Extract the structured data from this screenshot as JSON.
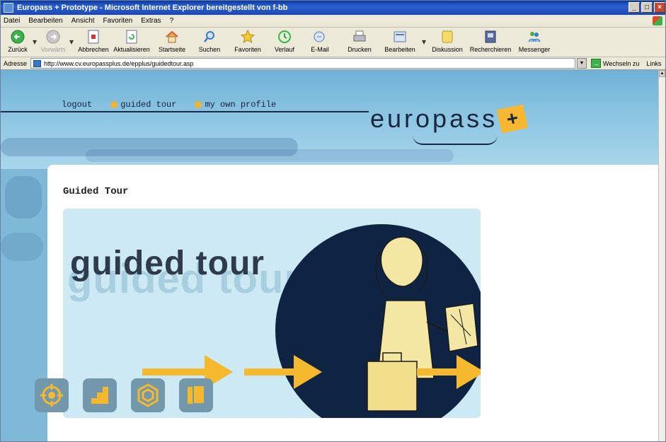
{
  "window": {
    "title": "Europass + Prototype - Microsoft Internet Explorer bereitgestellt von f-bb"
  },
  "menu": [
    "Datei",
    "Bearbeiten",
    "Ansicht",
    "Favoriten",
    "Extras",
    "?"
  ],
  "toolbar": {
    "back": "Zurück",
    "forward": "Vorwärts",
    "stop": "Abbrechen",
    "refresh": "Aktualisieren",
    "home": "Startseite",
    "search": "Suchen",
    "favorites": "Favoriten",
    "history": "Verlauf",
    "mail": "E-Mail",
    "print": "Drucken",
    "edit": "Bearbeiten",
    "discuss": "Diskussion",
    "research": "Recherchieren",
    "messenger": "Messenger"
  },
  "address": {
    "label": "Adresse",
    "url": "http://www.cv.europassplus.de/epplus/guidedtour.asp",
    "go": "Wechseln zu",
    "links": "Links"
  },
  "site": {
    "nav": {
      "logout": "logout",
      "guided_tour": "guided tour",
      "my_profile": "my own profile"
    },
    "logo": {
      "wordmark": "europass",
      "plus": "+"
    },
    "page_title": "Guided Tour",
    "hero": {
      "headline": "guided tour",
      "ghost_text": "guided tour"
    }
  },
  "colors": {
    "accent_yellow": "#f6b82c",
    "navy": "#0f2443",
    "sky": "#7fb9d8",
    "icon_tile": "#7398ac"
  }
}
